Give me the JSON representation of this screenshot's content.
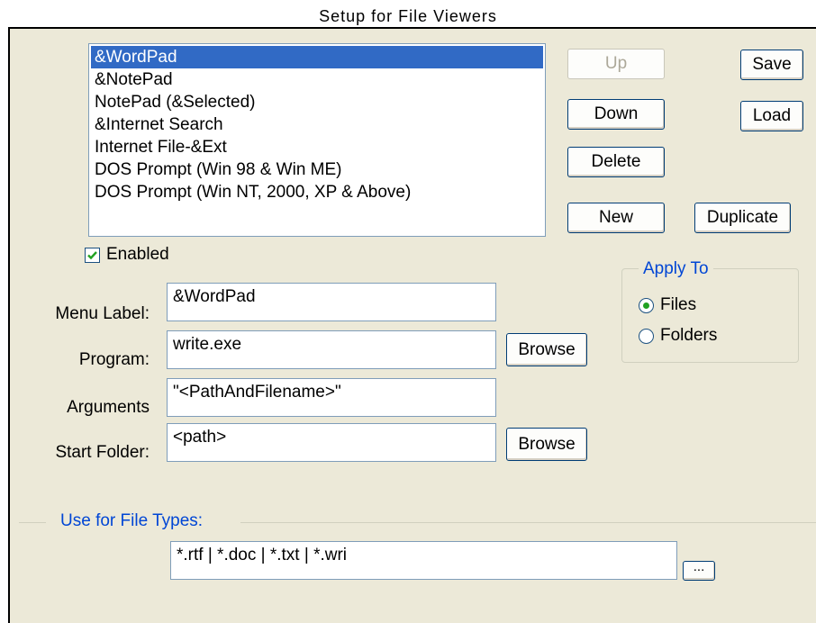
{
  "window": {
    "title": "Setup for File Viewers"
  },
  "viewers": {
    "items": [
      "&WordPad",
      "&NotePad",
      "NotePad (&Selected)",
      "&Internet Search",
      "Internet File-&Ext",
      "DOS Prompt (Win 98 & Win ME)",
      "DOS Prompt (Win NT, 2000, XP & Above)"
    ],
    "selected": "&WordPad"
  },
  "buttons": {
    "up": "Up",
    "down": "Down",
    "delete": "Delete",
    "new": "New",
    "duplicate": "Duplicate",
    "save": "Save",
    "load": "Load",
    "browse_program": "Browse",
    "browse_folder": "Browse",
    "file_types_more": "..."
  },
  "enabled": {
    "label": "Enabled",
    "checked": true
  },
  "form": {
    "menu_label": {
      "label": "Menu Label:",
      "value": "&WordPad"
    },
    "program": {
      "label": "Program:",
      "value": "write.exe"
    },
    "arguments": {
      "label": "Arguments",
      "value": "\"<PathAndFilename>\""
    },
    "start_folder": {
      "label": "Start Folder:",
      "value": "<path>"
    }
  },
  "apply_to": {
    "title": "Apply To",
    "options": [
      "Files",
      "Folders"
    ],
    "selected": "Files"
  },
  "file_types": {
    "title": "Use for File Types:",
    "value": "*.rtf | *.doc | *.txt | *.wri"
  },
  "colors": {
    "dialog_bg": "#ece9d8",
    "selection": "#316ac5",
    "group_title": "#0046d5",
    "check": "#21a121"
  }
}
